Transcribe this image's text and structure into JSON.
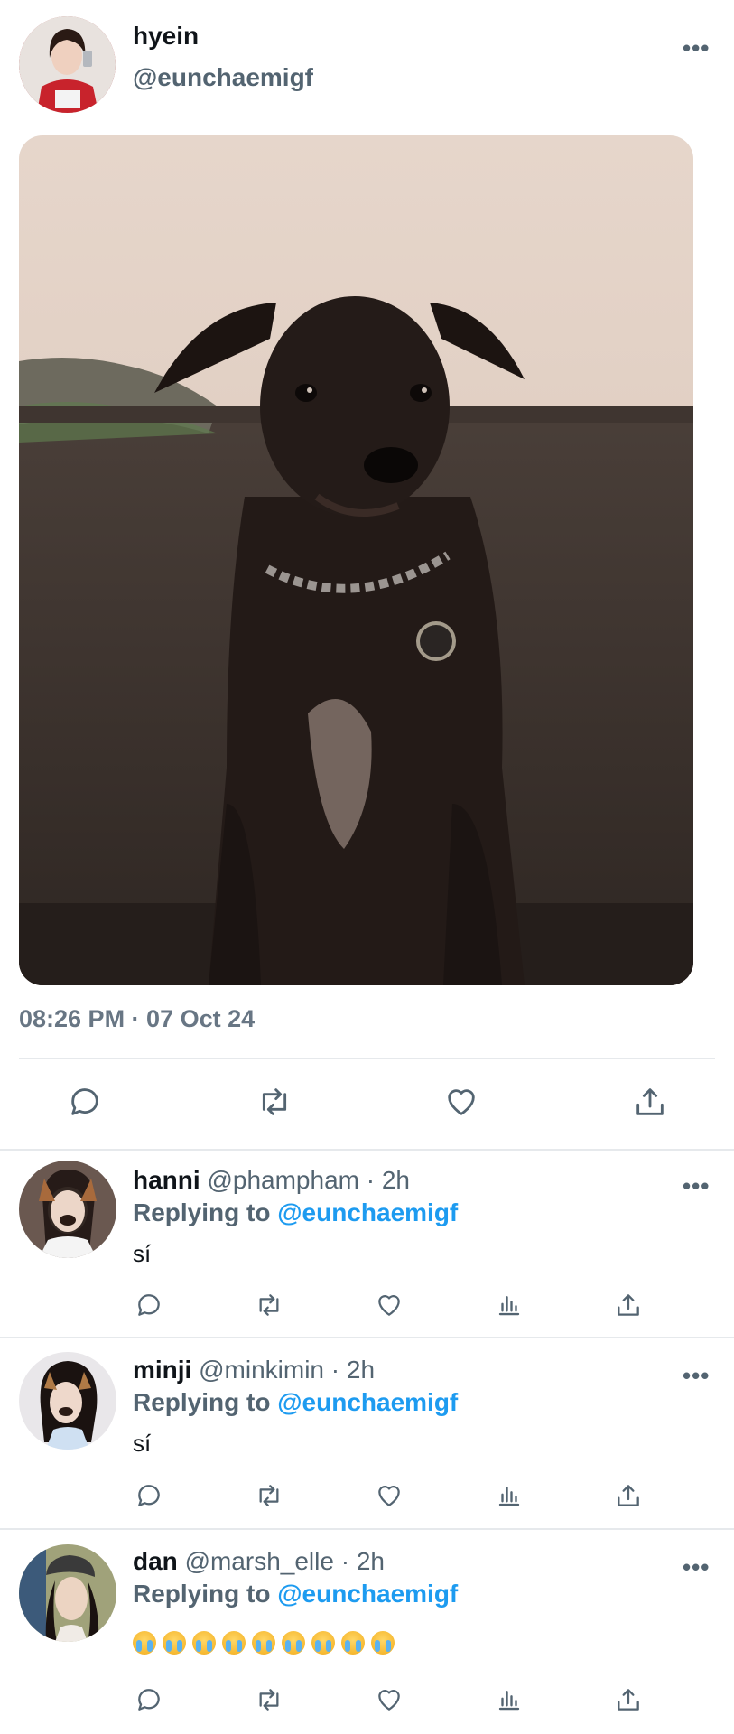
{
  "tweet": {
    "author_name": "hyein",
    "author_handle": "@eunchaemigf",
    "more_label": "•••",
    "timestamp": "08:26 PM · 07 Oct 24"
  },
  "replies": [
    {
      "name": "hanni",
      "handle": "@phampham",
      "time": "· 2h",
      "replying_prefix": "Replying to",
      "replying_to": "@eunchaemigf",
      "text": "sí"
    },
    {
      "name": "minji",
      "handle": "@minkimin",
      "time": "· 2h",
      "replying_prefix": "Replying to",
      "replying_to": "@eunchaemigf",
      "text": "sí"
    },
    {
      "name": "dan",
      "handle": "@marsh_elle",
      "time": "· 2h",
      "replying_prefix": "Replying to",
      "replying_to": "@eunchaemigf",
      "text": "",
      "emoji_count": 9,
      "emoji_name": "loudly-crying-face"
    }
  ],
  "icons": {
    "reply": "reply-icon",
    "retweet": "retweet-icon",
    "like": "like-icon",
    "views": "views-icon",
    "share": "share-icon"
  },
  "colors": {
    "text": "#0f1419",
    "secondary": "#536471",
    "accent": "#1d9bf0",
    "divider": "#e6e9ec"
  }
}
